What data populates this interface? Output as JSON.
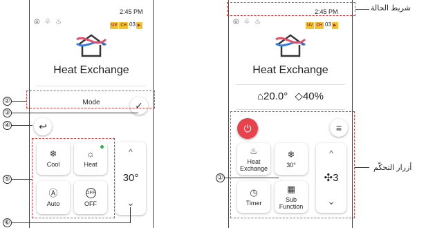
{
  "left_phone": {
    "time": "2:45 PM",
    "status_icons": "◎ ♧ ♨",
    "badges": [
      "UV",
      "CH",
      "03"
    ],
    "title": "Heat Exchange",
    "mode_label": "Mode",
    "tiles": [
      {
        "icon": "❄",
        "label": "Cool"
      },
      {
        "icon": "☼",
        "label": "Heat"
      },
      {
        "icon": "Ⓐ",
        "label": "Auto"
      },
      {
        "icon": "OFF",
        "label": "OFF"
      }
    ],
    "temp": "30°",
    "up": "^",
    "down": "⌄"
  },
  "right_phone": {
    "time": "2:45 PM",
    "status_icons": "◎ ♧ ♨",
    "badges": [
      "UV",
      "CH",
      "03"
    ],
    "title": "Heat Exchange",
    "temp_reading": "20.0°",
    "humidity_reading": "40%",
    "tiles": [
      {
        "icon": "♨",
        "label": "Heat Exchange"
      },
      {
        "icon": "❄",
        "label": "30°"
      },
      {
        "icon": "◷",
        "label": "Timer"
      },
      {
        "icon": "▦",
        "label": "Sub Function"
      }
    ],
    "fan_value": "3",
    "up": "^",
    "down": "⌄"
  },
  "callouts": {
    "c1": "①",
    "c2": "②",
    "c3": "③",
    "c4": "④",
    "c5": "⑤",
    "c6": "⑥"
  },
  "labels": {
    "status_bar": "شريط الحالة",
    "control_buttons": "أزرار التحكّم"
  }
}
